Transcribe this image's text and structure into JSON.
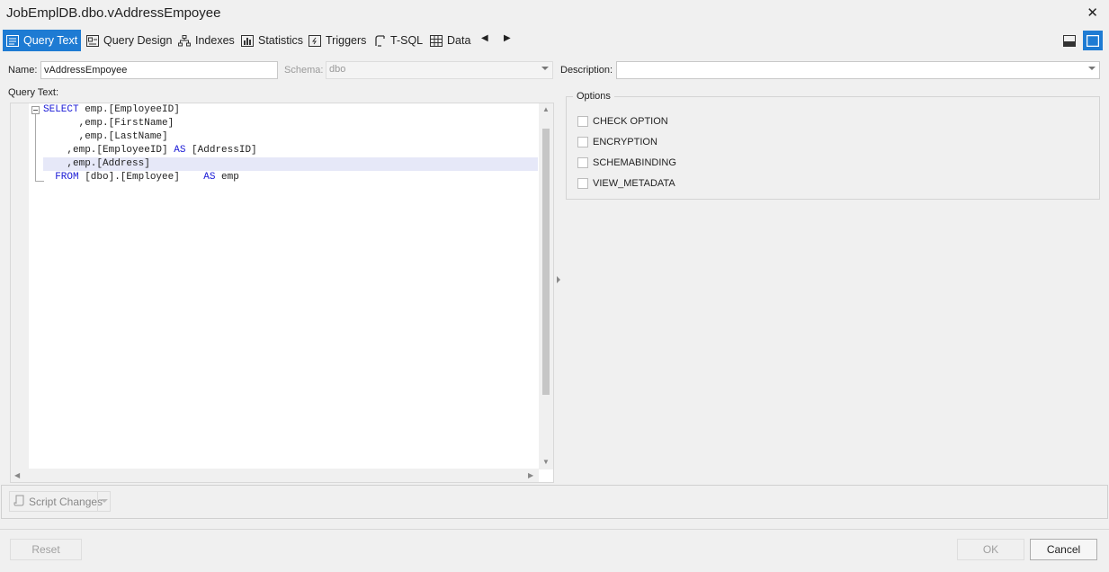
{
  "window": {
    "title": "JobEmplDB.dbo.vAddressEmpoyee",
    "close_glyph": "✕"
  },
  "toolbar": {
    "tabs": [
      {
        "label": "Query Text",
        "icon": "query-text-icon",
        "active": true
      },
      {
        "label": "Query Design",
        "icon": "query-design-icon",
        "active": false
      },
      {
        "label": "Indexes",
        "icon": "indexes-icon",
        "active": false
      },
      {
        "label": "Statistics",
        "icon": "statistics-icon",
        "active": false
      },
      {
        "label": "Triggers",
        "icon": "triggers-icon",
        "active": false
      },
      {
        "label": "T-SQL",
        "icon": "t-sql-icon",
        "active": false
      },
      {
        "label": "Data",
        "icon": "data-grid-icon",
        "active": false
      }
    ],
    "prev_glyph": "◀",
    "next_glyph": "▶",
    "layout_buttons": [
      "horizontal-split-icon",
      "single-panel-icon"
    ],
    "active_color": "#1e7bd3"
  },
  "form": {
    "name_label": "Name:",
    "name_value": "vAddressEmpoyee",
    "schema_label": "Schema:",
    "schema_value": "dbo",
    "description_label": "Description:",
    "description_value": "",
    "query_text_label": "Query Text:"
  },
  "editor": {
    "lines": [
      {
        "kw": "SELECT",
        "rest": " emp.[EmployeeID]"
      },
      {
        "kw": "",
        "rest": "      ,emp.[FirstName]"
      },
      {
        "kw": "",
        "rest": "      ,emp.[LastName]"
      },
      {
        "kw": "",
        "rest": "    ,emp.[EmployeeID] ",
        "kw2": "AS",
        "rest2": " [AddressID]"
      },
      {
        "kw": "",
        "rest": "    ,emp.[Address]"
      },
      {
        "kw": "  FROM",
        "rest": " [dbo].[Employee]    ",
        "kw2": "AS",
        "rest2": " emp"
      }
    ],
    "keyword_color": "#1a1ad6"
  },
  "options": {
    "title": "Options",
    "items": [
      {
        "label": "CHECK OPTION",
        "checked": false
      },
      {
        "label": "ENCRYPTION",
        "checked": false
      },
      {
        "label": "SCHEMABINDING",
        "checked": false
      },
      {
        "label": "VIEW_METADATA",
        "checked": false
      }
    ]
  },
  "footer": {
    "script_changes_label": "Script Changes",
    "reset_label": "Reset",
    "ok_label": "OK",
    "cancel_label": "Cancel"
  }
}
